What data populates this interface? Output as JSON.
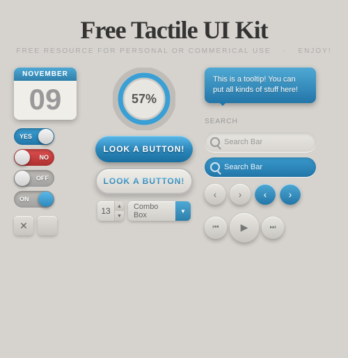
{
  "header": {
    "title": "Free Tactile UI Kit",
    "subtitle": "Free Resource for Personal or Commerical Use",
    "dot": "·",
    "enjoy": "Enjoy!"
  },
  "calendar": {
    "month": "November",
    "day": "09"
  },
  "progress": {
    "percent": "57%",
    "value": 57
  },
  "tooltip": {
    "text": "This is a tooltip! You can put all kinds of stuff here!"
  },
  "toggles": {
    "yes_label": "YES",
    "no_label": "NO",
    "off_label": "OFF",
    "on_label": "ON"
  },
  "buttons": {
    "btn1": "Look A Button!",
    "btn2": "Look A Button!"
  },
  "search": {
    "label1": "Search",
    "bar1": "Search Bar",
    "bar2": "Search Bar"
  },
  "spinner": {
    "value": "13"
  },
  "combo": {
    "label": "Combo Box"
  },
  "pagination": {
    "prev": "‹",
    "next": "›",
    "prev2": "‹",
    "next2": "›"
  },
  "media": {
    "rewind": "«",
    "play": "▶",
    "forward": "»"
  }
}
